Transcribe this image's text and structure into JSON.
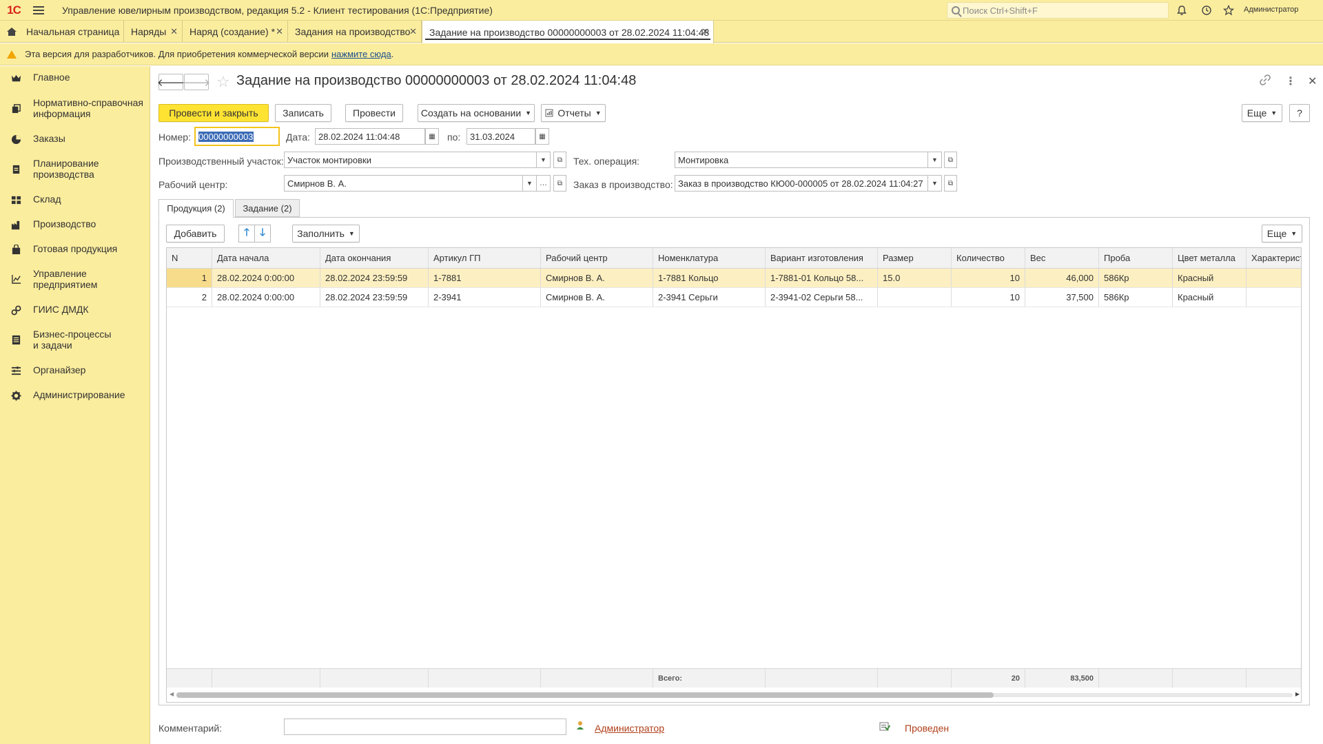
{
  "app": {
    "logo": "1С",
    "title": "Управление ювелирным производством, редакция 5.2  - Клиент тестирования (1С:Предприятие)",
    "search_placeholder": "Поиск Ctrl+Shift+F",
    "user": "Администратор"
  },
  "tabs": [
    {
      "label": "Начальная страница"
    },
    {
      "label": "Наряды"
    },
    {
      "label": "Наряд (создание) *"
    },
    {
      "label": "Задания на производство"
    },
    {
      "label": "Задание на производство 00000000003 от 28.02.2024 11:04:48"
    }
  ],
  "warning": {
    "text": "Эта версия для разработчиков. Для приобретения коммерческой версии",
    "link": "нажмите сюда",
    "tail": "."
  },
  "sidebar": {
    "items": [
      {
        "label": "Главное",
        "icon": "crown-icon"
      },
      {
        "label": "Нормативно-справочная информация",
        "icon": "books-icon"
      },
      {
        "label": "Заказы",
        "icon": "pie-icon"
      },
      {
        "label": "Планирование производства",
        "icon": "clipboard-icon"
      },
      {
        "label": "Склад",
        "icon": "grid-icon"
      },
      {
        "label": "Производство",
        "icon": "factory-icon"
      },
      {
        "label": "Готовая продукция",
        "icon": "bag-icon"
      },
      {
        "label": "Управление предприятием",
        "icon": "chart-icon"
      },
      {
        "label": "ГИИС ДМДК",
        "icon": "link-icon"
      },
      {
        "label": "Бизнес-процессы и задачи",
        "icon": "list-icon"
      },
      {
        "label": "Органайзер",
        "icon": "organizer-icon"
      },
      {
        "label": "Администрирование",
        "icon": "gear-icon"
      }
    ]
  },
  "form": {
    "title": "Задание на производство 00000000003 от 28.02.2024 11:04:48",
    "buttons": {
      "post_close": "Провести и закрыть",
      "save": "Записать",
      "post": "Провести",
      "create_based": "Создать на основании",
      "reports": "Отчеты",
      "more": "Еще",
      "help": "?"
    },
    "fields": {
      "number_label": "Номер:",
      "number_value": "00000000003",
      "date_label": "Дата:",
      "date_value": "28.02.2024 11:04:48",
      "to_label": "по:",
      "to_value": "31.03.2024",
      "section_label": "Производственный участок:",
      "section_value": "Участок монтировки",
      "operation_label": "Тех. операция:",
      "operation_value": "Монтировка",
      "workcenter_label": "Рабочий центр:",
      "workcenter_value": "Смирнов В. А.",
      "order_label": "Заказ в производство:",
      "order_value": "Заказ в производство КЮ00-000005 от 28.02.2024 11:04:27"
    },
    "page_tabs": [
      "Продукция (2)",
      "Задание (2)"
    ],
    "table_toolbar": {
      "add": "Добавить",
      "fill": "Заполнить",
      "more": "Еще"
    },
    "table": {
      "columns": [
        "N",
        "Дата начала",
        "Дата окончания",
        "Артикул ГП",
        "Рабочий центр",
        "Номенклатура",
        "Вариант изготовления",
        "Размер",
        "Количество",
        "Вес",
        "Проба",
        "Цвет металла",
        "Характеристика"
      ],
      "rows": [
        [
          "1",
          "28.02.2024 0:00:00",
          "28.02.2024 23:59:59",
          "1-7881",
          "Смирнов В. А.",
          "1-7881 Кольцо",
          "1-7881-01 Кольцо 58...",
          "15.0",
          "10",
          "46,000",
          "586Кр",
          "Красный",
          ""
        ],
        [
          "2",
          "28.02.2024 0:00:00",
          "28.02.2024 23:59:59",
          "2-3941",
          "Смирнов В. А.",
          "2-3941 Серьги",
          "2-3941-02 Серьги 58...",
          "",
          "10",
          "37,500",
          "586Кр",
          "Красный",
          ""
        ]
      ],
      "footer": {
        "total_label": "Всего:",
        "qty_total": "20",
        "weight_total": "83,500"
      }
    },
    "comment_label": "Комментарий:",
    "comment_value": "",
    "author": "Администратор",
    "status": "Проведен"
  },
  "colors": {
    "chrome": "#FBED9E",
    "primary_button": "#FFE333",
    "selected_row": "#FCEFC1",
    "link": "#b0401a"
  }
}
